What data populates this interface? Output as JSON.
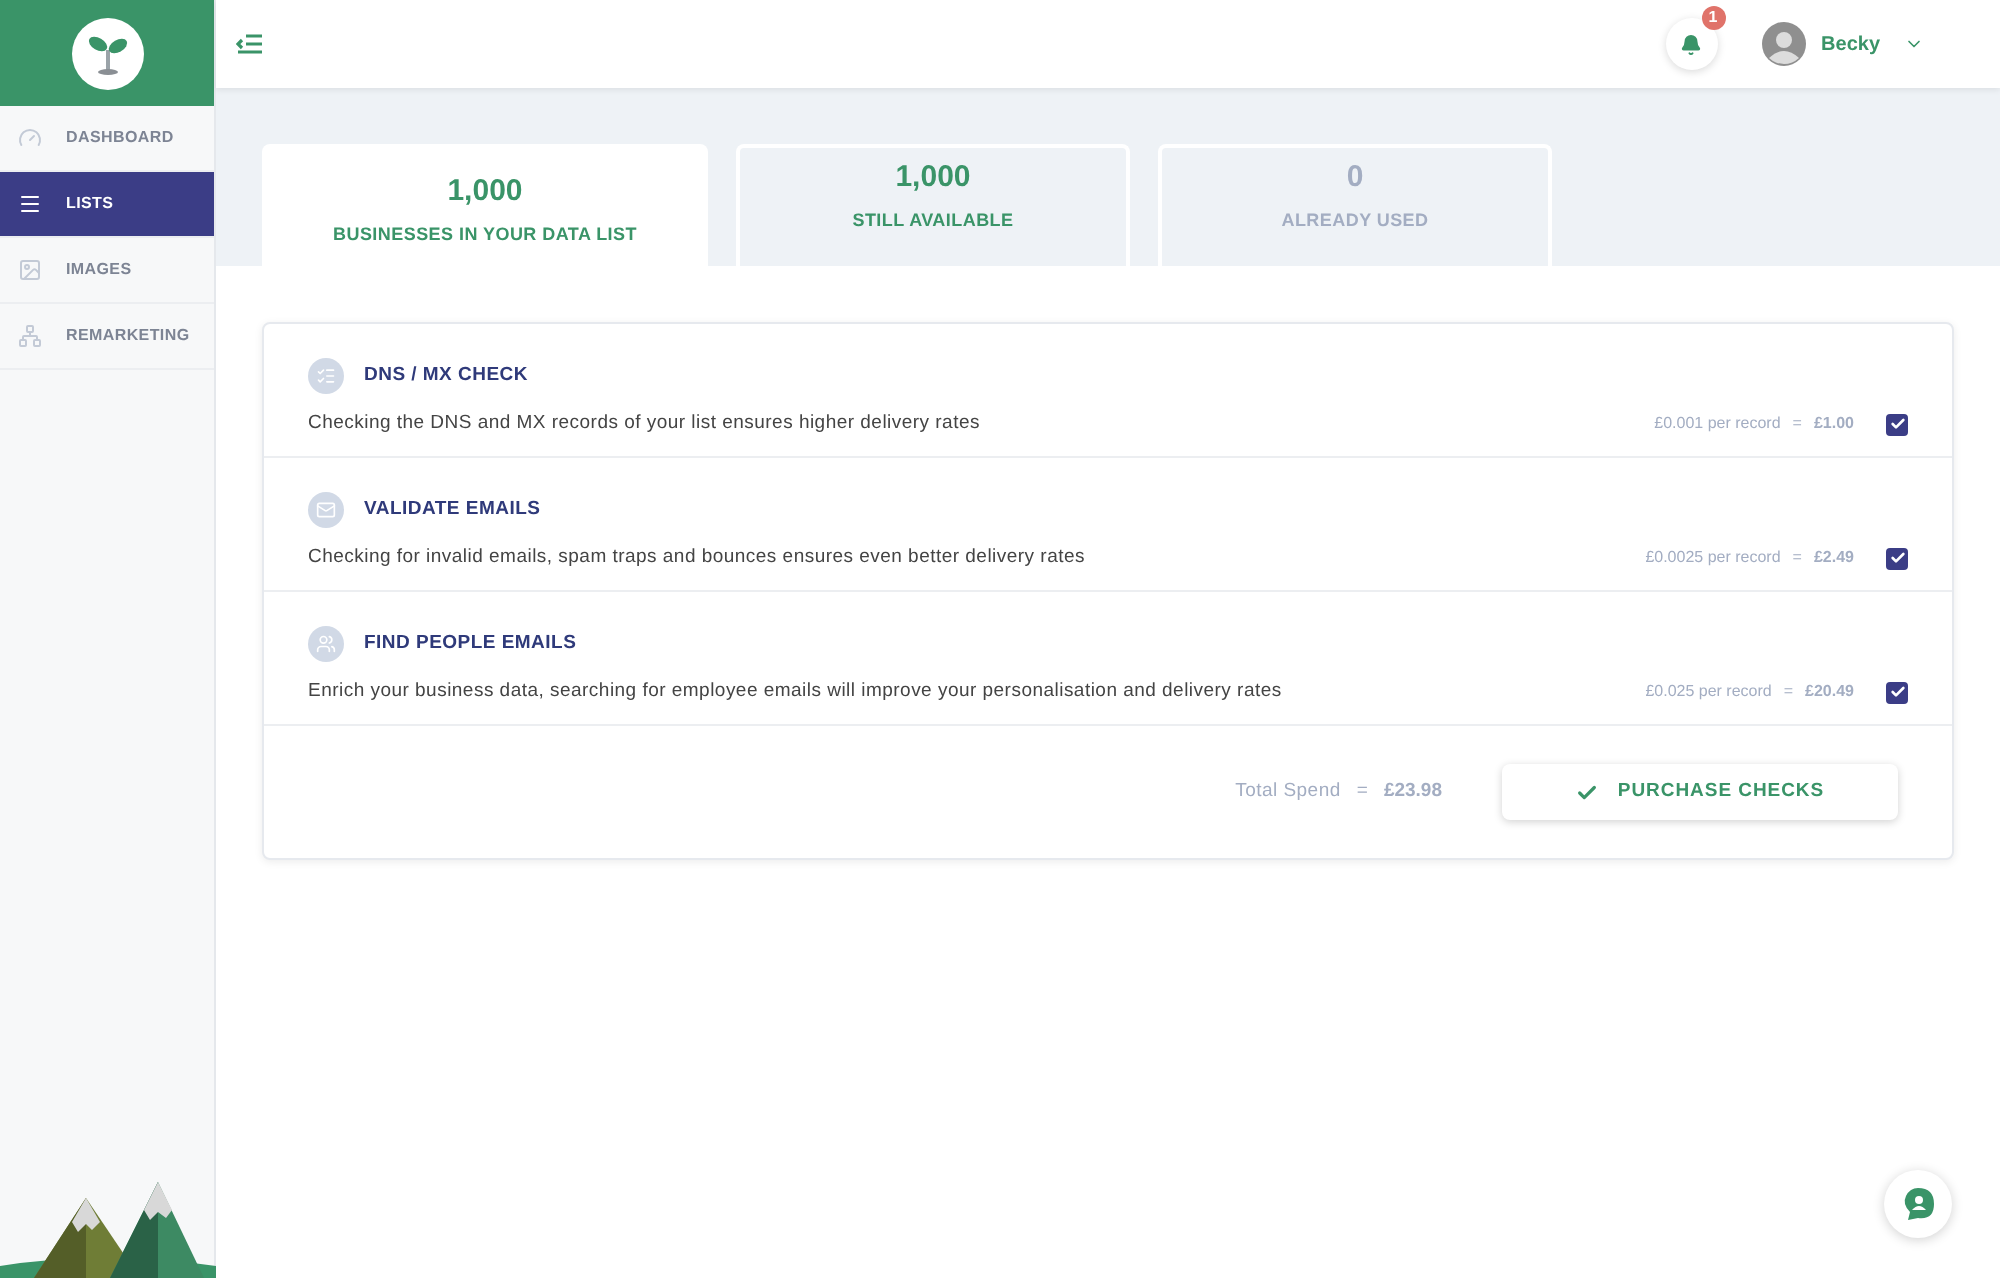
{
  "sidebar": {
    "items": [
      {
        "label": "DASHBOARD",
        "kind": "gauge",
        "selected": false
      },
      {
        "label": "LISTS",
        "kind": "menu",
        "selected": true
      },
      {
        "label": "IMAGES",
        "kind": "image",
        "selected": false
      },
      {
        "label": "REMARKETING",
        "kind": "network",
        "selected": false
      }
    ]
  },
  "topbar": {
    "notifications": "1",
    "user": "Becky"
  },
  "stats": [
    {
      "value": "1,000",
      "label": "BUSINESSES IN YOUR DATA LIST",
      "selected": true,
      "kind": "green"
    },
    {
      "value": "1,000",
      "label": "STILL AVAILABLE",
      "selected": false,
      "kind": "green"
    },
    {
      "value": "0",
      "label": "ALREADY USED",
      "selected": false,
      "kind": "muted"
    }
  ],
  "checks": [
    {
      "kind": "list",
      "title": "DNS / MX CHECK",
      "description": "Checking the DNS and MX records of your list ensures higher delivery rates",
      "rate": "£0.001 per record",
      "equals": "=",
      "cost": "£1.00",
      "checked": true
    },
    {
      "kind": "mail",
      "title": "VALIDATE EMAILS",
      "description": "Checking for invalid emails, spam traps and bounces ensures even better delivery rates",
      "rate": "£0.0025 per record",
      "equals": "=",
      "cost": "£2.49",
      "checked": true
    },
    {
      "kind": "people",
      "title": "FIND PEOPLE EMAILS",
      "description": "Enrich your business data, searching for employee emails will improve your personalisation and delivery rates",
      "rate": "£0.025 per record",
      "equals": "=",
      "cost": "£20.49",
      "checked": true
    }
  ],
  "total": {
    "label": "Total Spend",
    "equals": "=",
    "value": "£23.98"
  },
  "purchase_button": "PURCHASE CHECKS"
}
